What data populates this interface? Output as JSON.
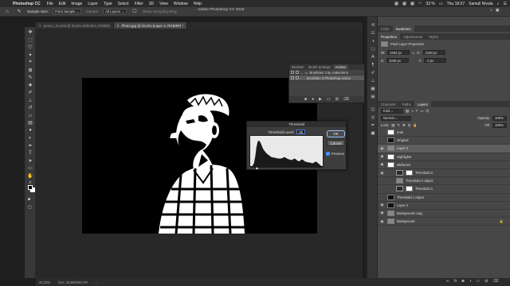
{
  "menubar": {
    "app": "Photoshop CC",
    "items": [
      "File",
      "Edit",
      "Image",
      "Layer",
      "Type",
      "Select",
      "Filter",
      "3D",
      "View",
      "Window",
      "Help"
    ],
    "battery": "33 %",
    "clock": "Thu 18.57",
    "user": "Samuli Nivala"
  },
  "window_title": "Adobe Photoshop CC 2018",
  "options": {
    "sample_size_label": "Sample Size:",
    "sample_size_value": "Point Sample",
    "sample_label": "Sample:",
    "sample_value": "All Layers",
    "show_ring": "Show Sampling Ring"
  },
  "tabs": [
    {
      "label": "promo_2.Land @ 33,3% (Glitches, RGB/8)"
    },
    {
      "label": "Photo.jpg @ 33,3% (Layer 3, RGB/8#) *"
    }
  ],
  "status": {
    "zoom": "33,33%",
    "doc": "Doc: 30,8M/393,7M"
  },
  "actions_panel": {
    "tabs": [
      "Brushes",
      "Brush Settings",
      "Actions"
    ],
    "rows": [
      {
        "label": "Brushtain 3 by codeinform"
      },
      {
        "label": "Brushtain 3 Photoshop Action"
      }
    ],
    "footer_icons": [
      "stop-icon",
      "record-icon",
      "play-icon",
      "folder-icon",
      "new-icon",
      "trash-icon"
    ]
  },
  "threshold": {
    "title": "Threshold",
    "level_label": "Threshold Level:",
    "level_value": "35",
    "ok": "OK",
    "cancel": "Cancel",
    "preview_label": "Preview",
    "preview_checked": true
  },
  "right": {
    "top_tabs": [
      "Color",
      "Swatches"
    ],
    "props_tabs": [
      "Properties",
      "Adjustments",
      "Styles"
    ],
    "props_title": "Pixel Layer Properties",
    "props": {
      "w_label": "W:",
      "w": "2304 px",
      "h_label": "H:",
      "h": "2160 px",
      "x_label": "X:",
      "x": "1040 px",
      "y_label": "Y:",
      "y": "-3 px",
      "go_label": "GO"
    },
    "layer_tabs": [
      "Channels",
      "Paths",
      "Layers"
    ],
    "kind_label": "Kind",
    "blend_mode": "Normal",
    "opacity_label": "Opacity:",
    "opacity": "100%",
    "lock_label": "Lock:",
    "fill_label": "Fill:",
    "fill": "100%"
  },
  "layers": [
    {
      "name": "eras",
      "thumb": "white",
      "vis": false,
      "sel": false,
      "type": "pixel"
    },
    {
      "name": "Original",
      "thumb": "dark",
      "vis": false,
      "sel": false,
      "type": "pixel"
    },
    {
      "name": "Layer 3",
      "thumb": "grey",
      "vis": true,
      "sel": true,
      "type": "pixel"
    },
    {
      "name": "Highlights",
      "thumb": "white",
      "vis": true,
      "sel": false,
      "type": "pixel"
    },
    {
      "name": "Midtones",
      "thumb": "white",
      "vis": true,
      "sel": false,
      "type": "pixel"
    },
    {
      "name": "Threshold 2",
      "thumb": "adj",
      "vis": true,
      "sel": false,
      "type": "adjust",
      "indent": true
    },
    {
      "name": "Threshold 2 object",
      "thumb": "grey",
      "vis": false,
      "sel": false,
      "type": "pixel",
      "indent": true
    },
    {
      "name": "Threshold 1",
      "thumb": "adj",
      "vis": false,
      "sel": false,
      "type": "adjust",
      "indent": true
    },
    {
      "name": "Threshold 1 object",
      "thumb": "dark",
      "vis": false,
      "sel": false,
      "type": "pixel"
    },
    {
      "name": "Layer 2",
      "thumb": "dark",
      "vis": true,
      "sel": false,
      "type": "pixel"
    },
    {
      "name": "Background copy",
      "thumb": "grey",
      "vis": true,
      "sel": false,
      "type": "pixel"
    },
    {
      "name": "Background",
      "thumb": "grey",
      "vis": true,
      "sel": false,
      "type": "pixel",
      "locked": true
    }
  ],
  "histogram": {
    "levels": [
      0,
      2,
      6,
      12,
      30,
      55,
      70,
      72,
      68,
      60,
      52,
      46,
      42,
      38,
      35,
      33,
      30,
      28,
      27,
      27,
      26,
      25,
      25,
      24,
      24,
      25,
      26,
      28,
      27,
      25,
      23,
      22,
      21,
      20,
      22,
      24,
      23,
      20,
      18,
      17,
      19,
      22,
      21,
      18,
      16,
      15,
      14,
      14,
      13,
      12,
      12,
      14,
      16,
      15,
      12,
      9,
      6,
      3,
      1,
      0
    ]
  },
  "colors": {
    "accent": "#4a7ccf",
    "ok_ring": "#9ec3ff"
  }
}
